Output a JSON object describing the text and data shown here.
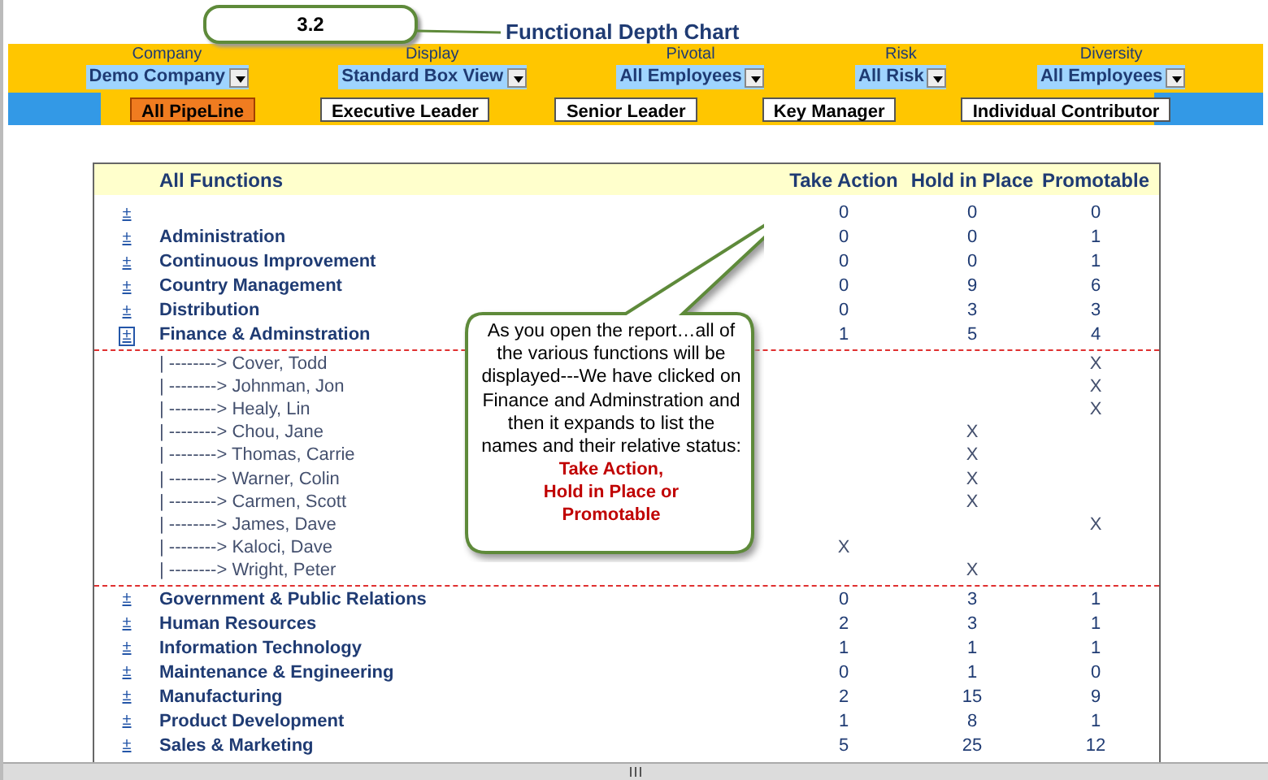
{
  "callout_box": {
    "label": "3.2"
  },
  "title": "Functional Depth Chart",
  "filters": [
    {
      "label": "Company",
      "value": "Demo Company"
    },
    {
      "label": "Display",
      "value": "Standard Box View"
    },
    {
      "label": "Pivotal",
      "value": "All Employees"
    },
    {
      "label": "Risk",
      "value": "All Risk"
    },
    {
      "label": "Diversity",
      "value": "All Employees"
    }
  ],
  "pipeline_tabs": [
    {
      "label": "All PipeLine",
      "selected": true
    },
    {
      "label": "Executive Leader",
      "selected": false
    },
    {
      "label": "Senior Leader",
      "selected": false
    },
    {
      "label": "Key Manager",
      "selected": false
    },
    {
      "label": "Individual Contributor",
      "selected": false
    }
  ],
  "table": {
    "columns": [
      "All Functions",
      "Take Action",
      "Hold in Place",
      "Promotable"
    ],
    "rows": [
      {
        "toggle": "±",
        "expanded": false,
        "take_action": "0",
        "hold_in_place": "0",
        "promotable": "0"
      },
      {
        "toggle": "±",
        "expanded": false,
        "name": "Administration",
        "take_action": "0",
        "hold_in_place": "0",
        "promotable": "1"
      },
      {
        "toggle": "±",
        "expanded": false,
        "name": "Continuous Improvement",
        "take_action": "0",
        "hold_in_place": "0",
        "promotable": "1"
      },
      {
        "toggle": "±",
        "expanded": false,
        "name": "Country Management",
        "take_action": "0",
        "hold_in_place": "9",
        "promotable": "6"
      },
      {
        "toggle": "±",
        "expanded": false,
        "name": "Distribution",
        "take_action": "0",
        "hold_in_place": "3",
        "promotable": "3"
      },
      {
        "toggle": "±",
        "expanded": true,
        "name": "Finance & Adminstration",
        "take_action": "1",
        "hold_in_place": "5",
        "promotable": "4",
        "children": [
          {
            "name": "| --------> Cover, Todd",
            "promotable": "X"
          },
          {
            "name": "| --------> Johnman, Jon",
            "promotable": "X"
          },
          {
            "name": "| --------> Healy, Lin",
            "promotable": "X"
          },
          {
            "name": "| --------> Chou, Jane",
            "hold_in_place": "X"
          },
          {
            "name": "| --------> Thomas, Carrie",
            "hold_in_place": "X"
          },
          {
            "name": "| --------> Warner, Colin",
            "hold_in_place": "X"
          },
          {
            "name": "| --------> Carmen, Scott",
            "hold_in_place": "X"
          },
          {
            "name": "| --------> James, Dave",
            "promotable": "X"
          },
          {
            "name": "| --------> Kaloci, Dave",
            "take_action": "X"
          },
          {
            "name": "| --------> Wright, Peter",
            "hold_in_place": "X"
          }
        ]
      },
      {
        "toggle": "±",
        "expanded": false,
        "name": "Government & Public Relations",
        "take_action": "0",
        "hold_in_place": "3",
        "promotable": "1"
      },
      {
        "toggle": "±",
        "expanded": false,
        "name": "Human Resources",
        "take_action": "2",
        "hold_in_place": "3",
        "promotable": "1"
      },
      {
        "toggle": "±",
        "expanded": false,
        "name": "Information Technology",
        "take_action": "1",
        "hold_in_place": "1",
        "promotable": "1"
      },
      {
        "toggle": "±",
        "expanded": false,
        "name": "Maintenance & Engineering",
        "take_action": "0",
        "hold_in_place": "1",
        "promotable": "0"
      },
      {
        "toggle": "±",
        "expanded": false,
        "name": "Manufacturing",
        "take_action": "2",
        "hold_in_place": "15",
        "promotable": "9"
      },
      {
        "toggle": "±",
        "expanded": false,
        "name": "Product Development",
        "take_action": "1",
        "hold_in_place": "8",
        "promotable": "1"
      },
      {
        "toggle": "±",
        "expanded": false,
        "name": "Sales & Marketing",
        "take_action": "5",
        "hold_in_place": "25",
        "promotable": "12"
      }
    ]
  },
  "speech_bubble": {
    "text": "As you open the report…all of the various functions will be displayed---We have clicked on Finance and Adminstration and then it expands to list the names and their relative status:",
    "emphasis": [
      "Take Action,",
      "Hold in Place or",
      "Promotable"
    ]
  }
}
